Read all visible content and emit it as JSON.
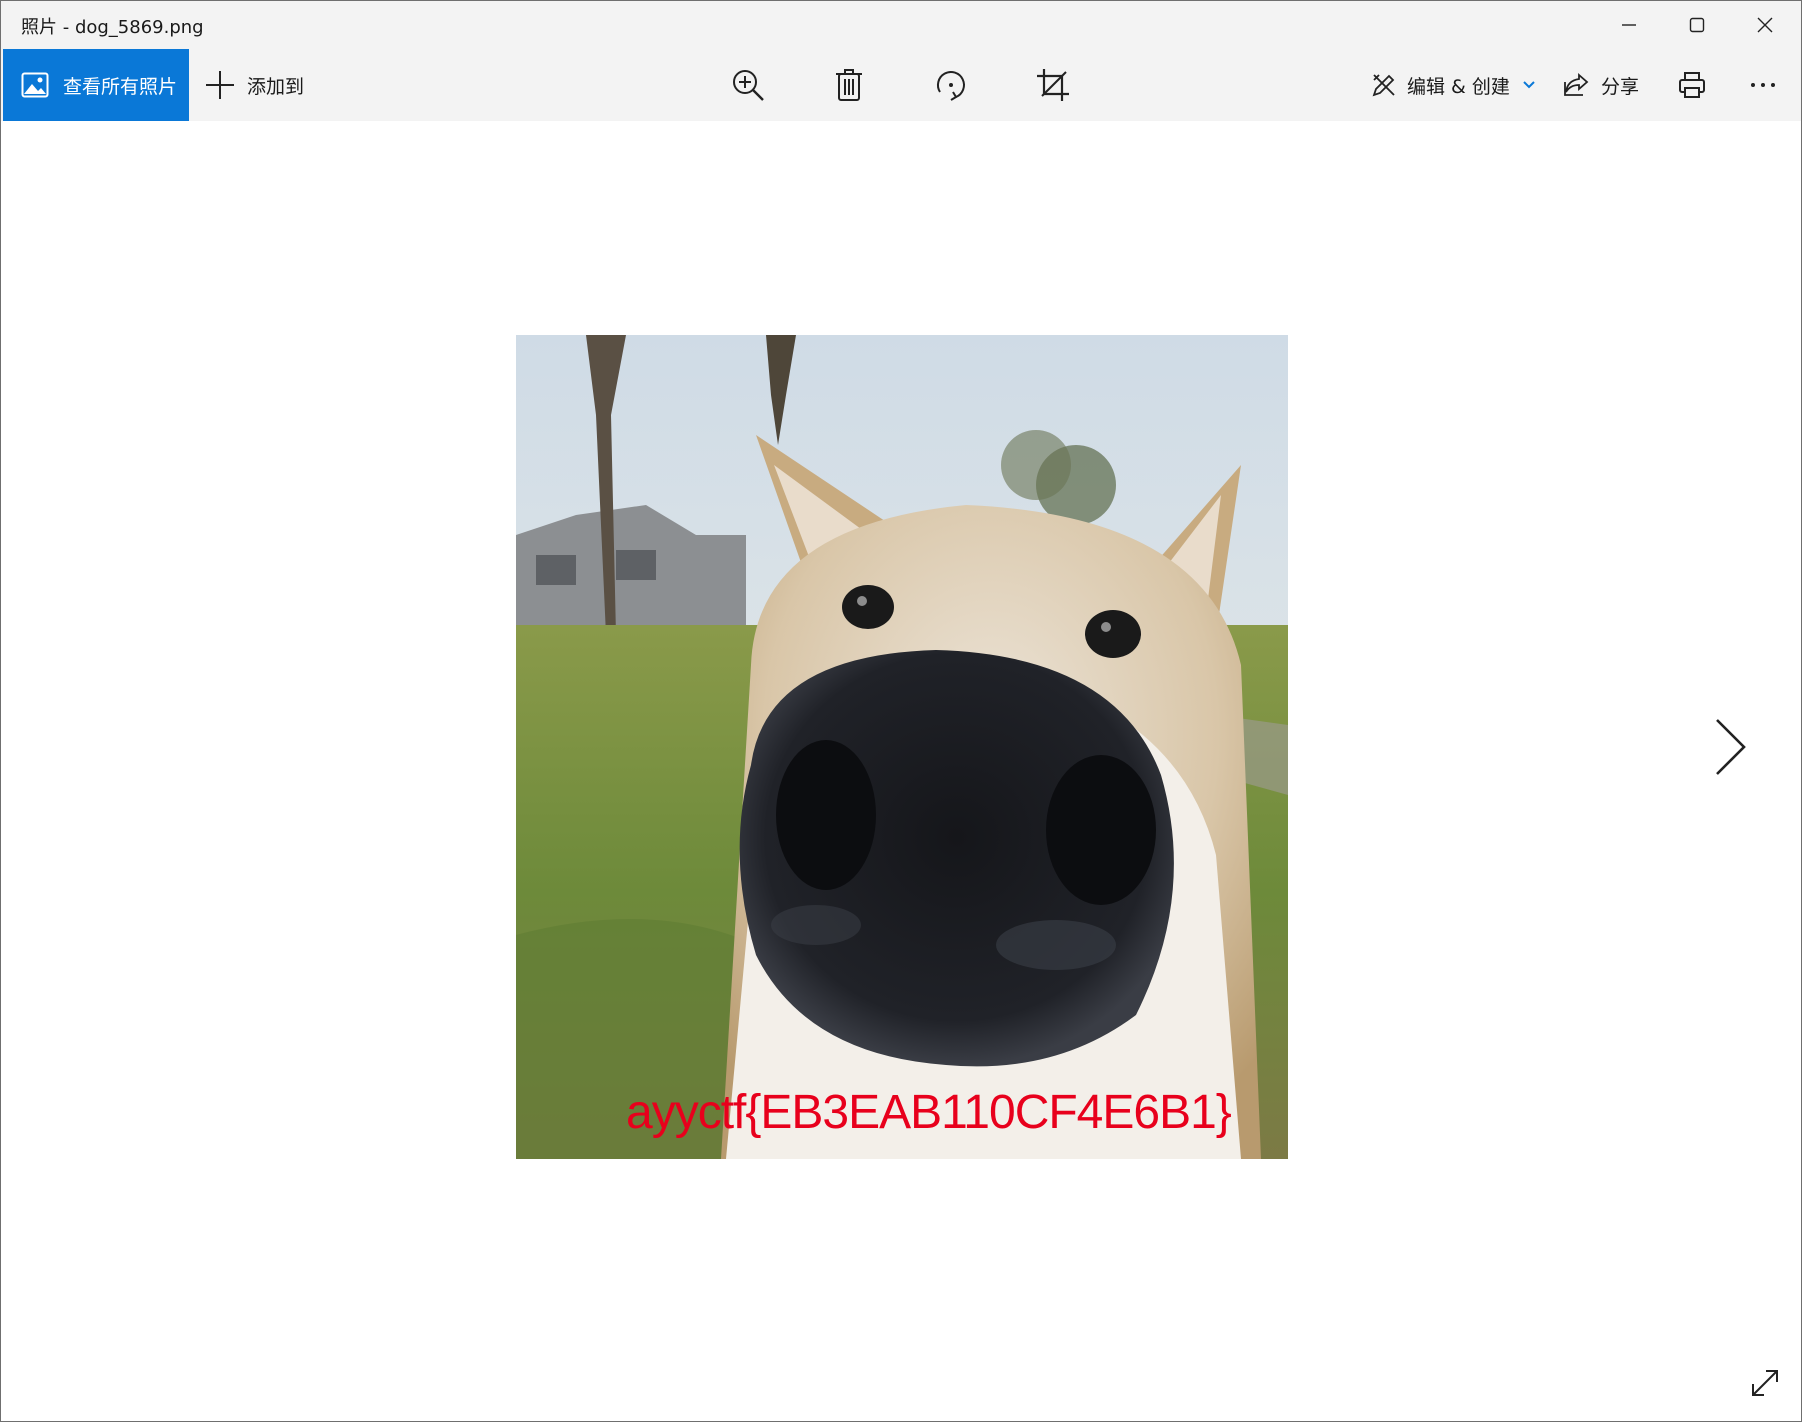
{
  "window": {
    "title": "照片 - dog_5869.png"
  },
  "toolbar": {
    "view_all_label": "查看所有照片",
    "add_to_label": "添加到",
    "edit_create_label": "编辑 & 创建",
    "share_label": "分享",
    "icons": [
      "zoom-in-icon",
      "delete-icon",
      "rotate-icon",
      "crop-icon",
      "print-icon",
      "more-icon"
    ]
  },
  "photo": {
    "caption": "ayyctf{EB3EAB110CF4E6B1}",
    "caption_color": "#e8001c"
  },
  "colors": {
    "accent": "#0a78d7",
    "chrome": "#f3f3f3"
  }
}
